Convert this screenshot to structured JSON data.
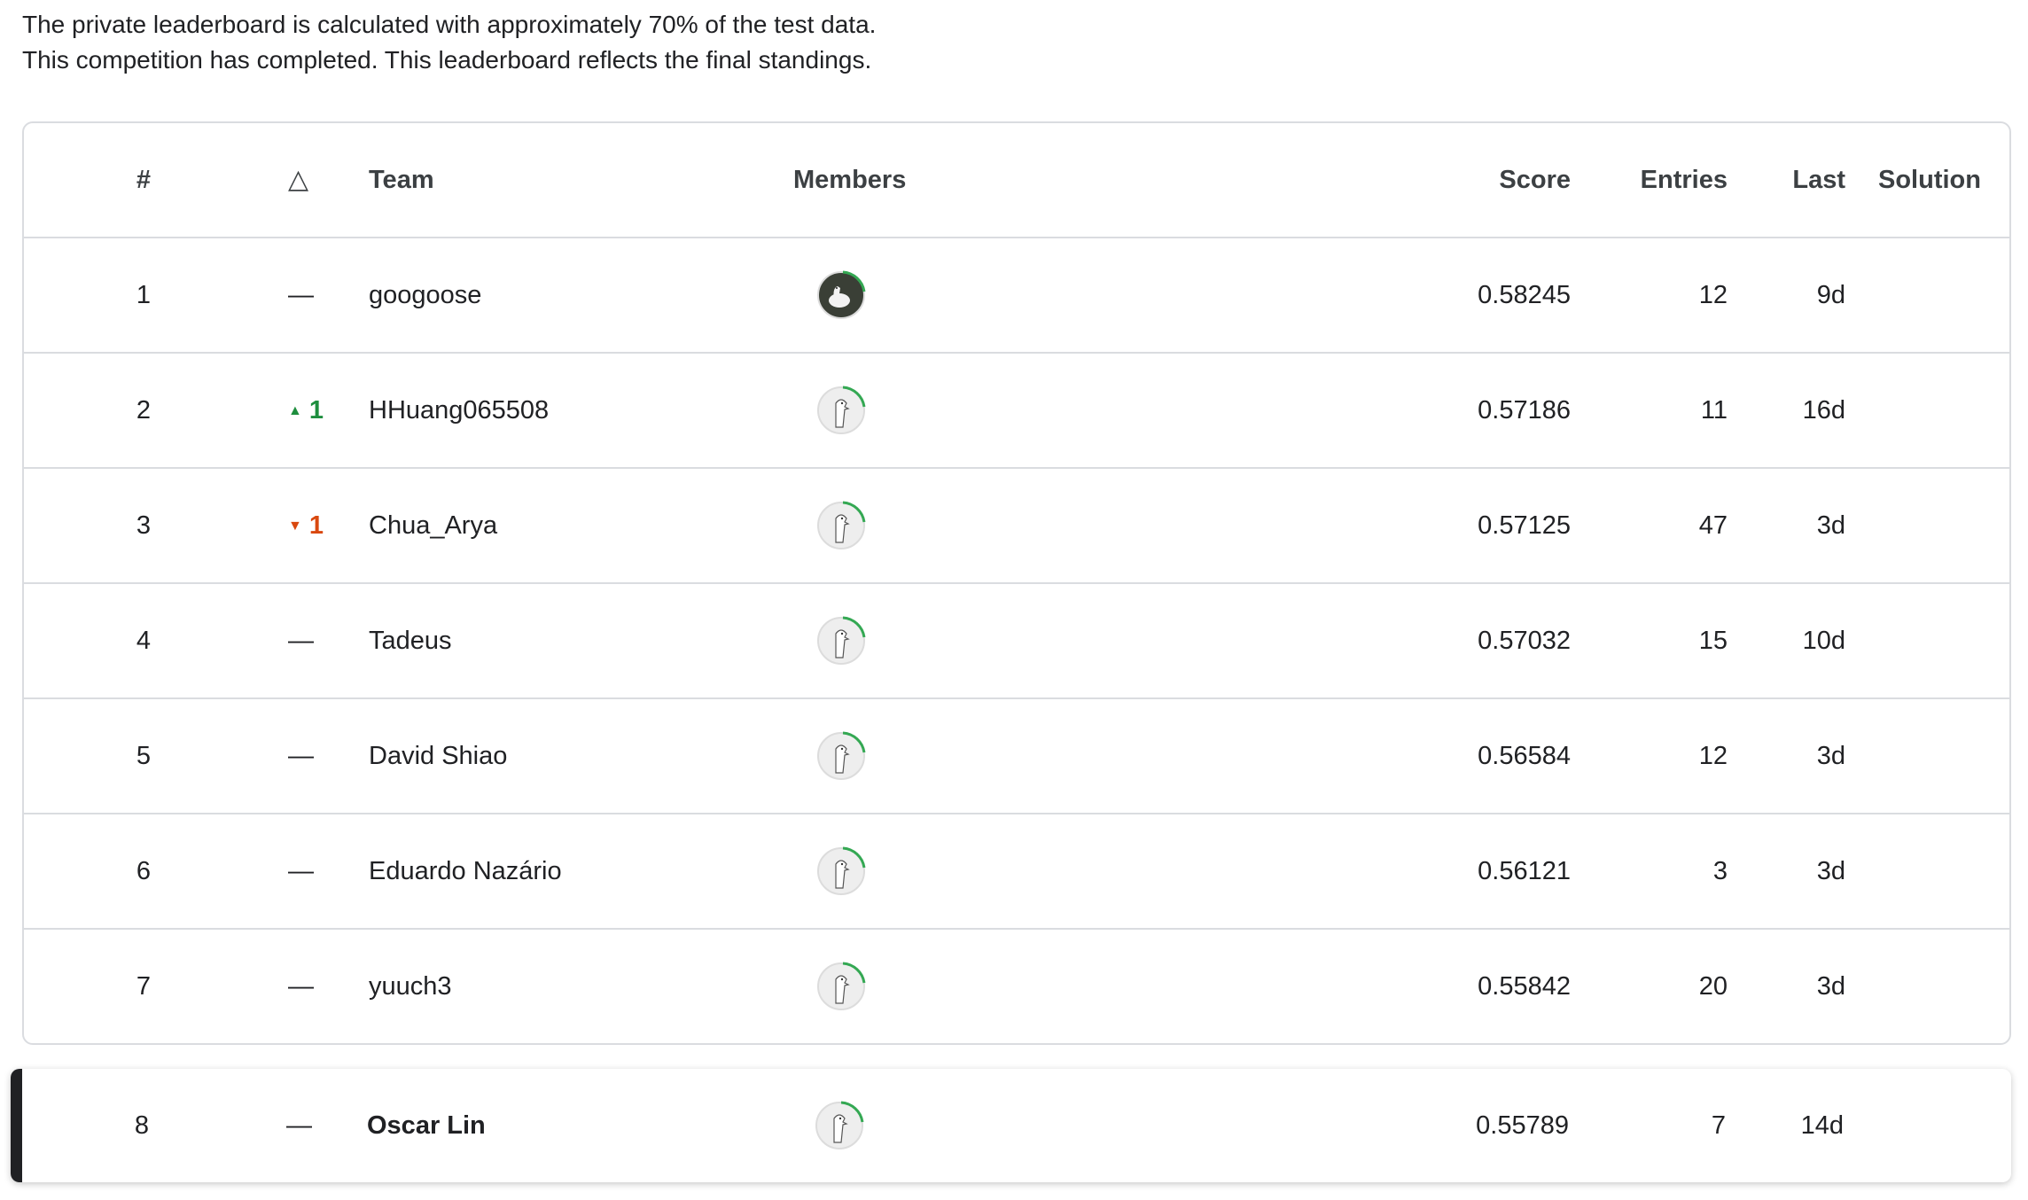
{
  "notes": {
    "line1": "The private leaderboard is calculated with approximately 70% of the test data.",
    "line2": "This competition has completed. This leaderboard reflects the final standings."
  },
  "columns": {
    "rank": "#",
    "delta": "△",
    "team": "Team",
    "members": "Members",
    "score": "Score",
    "entries": "Entries",
    "last": "Last",
    "solution": "Solution"
  },
  "rows": [
    {
      "rank": "1",
      "delta": "—",
      "delta_type": "none",
      "team": "googoose",
      "avatar": "photo-avatar",
      "score": "0.58245",
      "entries": "12",
      "last": "9d"
    },
    {
      "rank": "2",
      "delta": "1",
      "delta_type": "up",
      "team": "HHuang065508",
      "avatar": "default-goose-avatar",
      "score": "0.57186",
      "entries": "11",
      "last": "16d"
    },
    {
      "rank": "3",
      "delta": "1",
      "delta_type": "down",
      "team": "Chua_Arya",
      "avatar": "default-goose-avatar",
      "score": "0.57125",
      "entries": "47",
      "last": "3d"
    },
    {
      "rank": "4",
      "delta": "—",
      "delta_type": "none",
      "team": "Tadeus",
      "avatar": "default-goose-avatar",
      "score": "0.57032",
      "entries": "15",
      "last": "10d"
    },
    {
      "rank": "5",
      "delta": "—",
      "delta_type": "none",
      "team": "David Shiao",
      "avatar": "default-goose-avatar",
      "score": "0.56584",
      "entries": "12",
      "last": "3d"
    },
    {
      "rank": "6",
      "delta": "—",
      "delta_type": "none",
      "team": "Eduardo Nazário",
      "avatar": "default-goose-avatar",
      "score": "0.56121",
      "entries": "3",
      "last": "3d"
    },
    {
      "rank": "7",
      "delta": "—",
      "delta_type": "none",
      "team": "yuuch3",
      "avatar": "default-goose-avatar",
      "score": "0.55842",
      "entries": "20",
      "last": "3d"
    }
  ],
  "my_row": {
    "rank": "8",
    "delta": "—",
    "delta_type": "none",
    "team": "Oscar Lin",
    "avatar": "default-goose-avatar",
    "score": "0.55789",
    "entries": "7",
    "last": "14d"
  },
  "colors": {
    "up": "#1e8e3e",
    "down": "#d9480f",
    "progress_ring": "#34a853",
    "border": "#dadce0"
  }
}
